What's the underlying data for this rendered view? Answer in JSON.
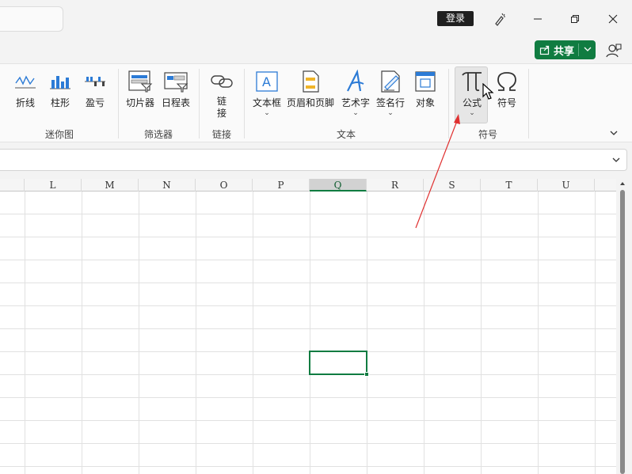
{
  "titlebar": {
    "login_label": "登录"
  },
  "share": {
    "label": "共享"
  },
  "ribbon": {
    "groups": {
      "sparklines": {
        "label": "迷你图",
        "items": [
          "折线",
          "柱形",
          "盈亏"
        ]
      },
      "filters": {
        "label": "筛选器",
        "items": [
          "切片器",
          "日程表"
        ]
      },
      "links": {
        "label": "链接",
        "item": "链\n接"
      },
      "text": {
        "label": "文本",
        "items": [
          "文本框",
          "页眉和页脚",
          "艺术字",
          "签名行",
          "对象"
        ]
      },
      "symbols": {
        "label": "符号",
        "items": [
          "公式",
          "符号"
        ]
      }
    }
  },
  "grid": {
    "columns": [
      "L",
      "M",
      "N",
      "O",
      "P",
      "Q",
      "R",
      "S",
      "T",
      "U"
    ],
    "selected_column": "Q"
  },
  "colors": {
    "accent": "#107c41",
    "annotation_arrow": "#e03030"
  }
}
